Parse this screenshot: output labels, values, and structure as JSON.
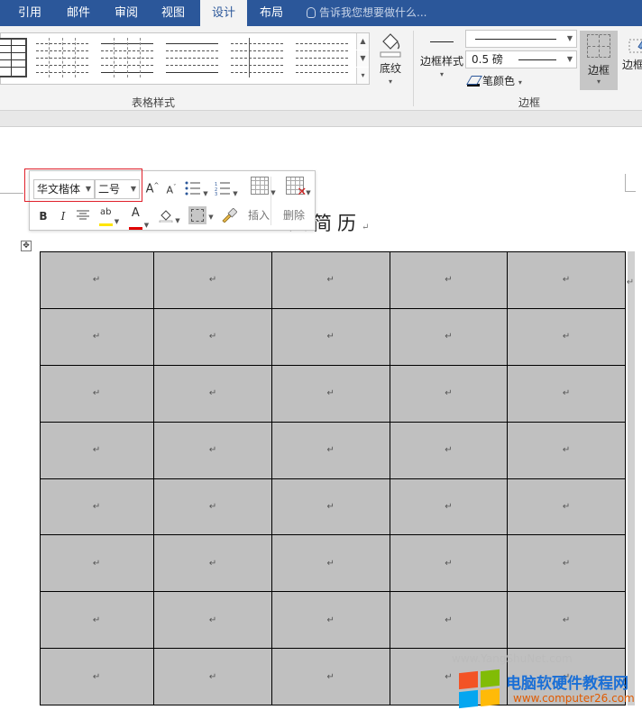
{
  "ribbon": {
    "tabs": [
      {
        "label": "引用",
        "active": false
      },
      {
        "label": "邮件",
        "active": false
      },
      {
        "label": "审阅",
        "active": false
      },
      {
        "label": "视图",
        "active": false
      },
      {
        "label": "设计",
        "active": true
      },
      {
        "label": "布局",
        "active": false
      }
    ],
    "tell_me": "告诉我您想要做什么...",
    "table_styles_group": "表格样式",
    "shading_label": "底纹",
    "border_styles_label": "边框样式",
    "pen_style_value": "",
    "pen_weight_value": "0.5 磅",
    "pen_color_label": "笔颜色",
    "borders_label": "边框",
    "border_painter_label": "边框",
    "borders_group": "边框"
  },
  "mini_toolbar": {
    "font_value": "华文楷体",
    "size_value": "二号",
    "bold": "B",
    "italic": "I",
    "grow_font": "A",
    "shrink_font": "A",
    "font_color_letter": "A",
    "insert_label": "插入",
    "delete_label": "删除"
  },
  "document": {
    "title": "人简历",
    "paragraph_mark": "↵",
    "table": {
      "rows": 8,
      "cols": 5,
      "cell_mark": "↵"
    }
  },
  "watermark": {
    "brand": "电脑软硬件教程网",
    "url": "www.computer26.com",
    "faint_text": "www.YangShuNet.com"
  },
  "colors": {
    "tab_bar": "#2b579a",
    "cell_shading": "#c0c0c0",
    "highlight": "#e0202a"
  }
}
